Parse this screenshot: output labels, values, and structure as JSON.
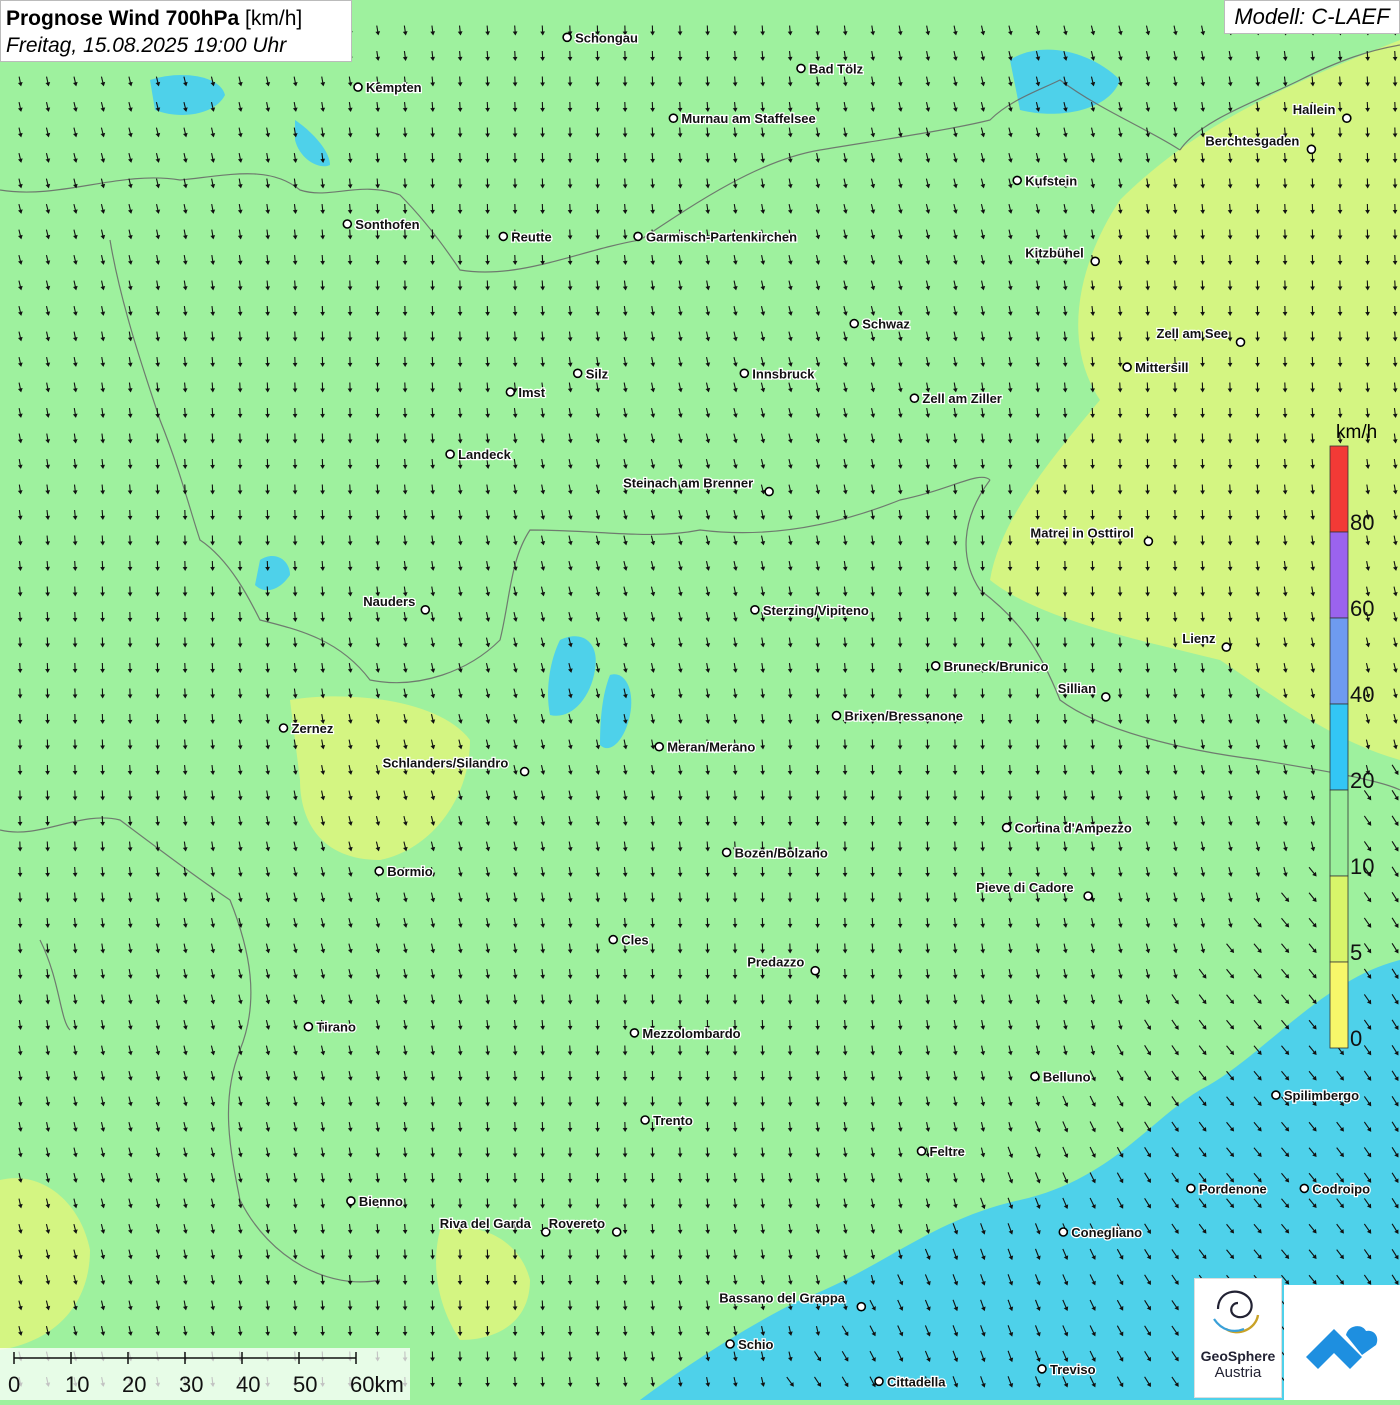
{
  "header": {
    "title_bold": "Prognose Wind 700hPa",
    "title_unit": "[km/h]",
    "datetime": "Freitag, 15.08.2025 19:00 Uhr"
  },
  "model_label": "Modell: C-LAEF",
  "colors": {
    "green_light": "#9ef19e",
    "yellow_light": "#d9f57e",
    "blue_light": "#45cdf2"
  },
  "legend": {
    "unit": "km/h",
    "classes": [
      {
        "label": "80",
        "color": "#f23a36"
      },
      {
        "label": "60",
        "color": "#9b63ee"
      },
      {
        "label": "40",
        "color": "#6e9bf0"
      },
      {
        "label": "20",
        "color": "#33c6f5"
      },
      {
        "label": "10",
        "color": "#99ef9b"
      },
      {
        "label": "5",
        "color": "#d8f56a"
      },
      {
        "label": "0",
        "color": "#f7f76a"
      }
    ]
  },
  "scale": {
    "ticks": [
      "0",
      "10",
      "20",
      "30",
      "40",
      "50",
      "60km"
    ]
  },
  "cities": [
    {
      "name": "Schongau",
      "lon": 10.9,
      "lat": 47.81
    },
    {
      "name": "Bad Tölz",
      "lon": 11.56,
      "lat": 47.76
    },
    {
      "name": "Kempten",
      "lon": 10.31,
      "lat": 47.73
    },
    {
      "name": "Murnau am Staffelsee",
      "lon": 11.2,
      "lat": 47.68
    },
    {
      "name": "Hallein",
      "lon": 13.1,
      "lat": 47.68
    },
    {
      "name": "Berchtesgaden",
      "lon": 13.0,
      "lat": 47.63
    },
    {
      "name": "Kufstein",
      "lon": 12.17,
      "lat": 47.58
    },
    {
      "name": "Sonthofen",
      "lon": 10.28,
      "lat": 47.51
    },
    {
      "name": "Reutte",
      "lon": 10.72,
      "lat": 47.49
    },
    {
      "name": "Garmisch-Partenkirchen",
      "lon": 11.1,
      "lat": 47.49
    },
    {
      "name": "Kitzbühel",
      "lon": 12.39,
      "lat": 47.45
    },
    {
      "name": "Schwaz",
      "lon": 11.71,
      "lat": 47.35
    },
    {
      "name": "Zell am See",
      "lon": 12.8,
      "lat": 47.32
    },
    {
      "name": "Innsbruck",
      "lon": 11.4,
      "lat": 47.27
    },
    {
      "name": "Mittersill",
      "lon": 12.48,
      "lat": 47.28
    },
    {
      "name": "Silz",
      "lon": 10.93,
      "lat": 47.27
    },
    {
      "name": "Imst",
      "lon": 10.74,
      "lat": 47.24
    },
    {
      "name": "Zell am Ziller",
      "lon": 11.88,
      "lat": 47.23
    },
    {
      "name": "Landeck",
      "lon": 10.57,
      "lat": 47.14
    },
    {
      "name": "Steinach am Brenner",
      "lon": 11.47,
      "lat": 47.08
    },
    {
      "name": "Matrei in Osttirol",
      "lon": 12.54,
      "lat": 47.0
    },
    {
      "name": "Nauders",
      "lon": 10.5,
      "lat": 46.89
    },
    {
      "name": "Sterzing/Vipiteno",
      "lon": 11.43,
      "lat": 46.89
    },
    {
      "name": "Lienz",
      "lon": 12.76,
      "lat": 46.83
    },
    {
      "name": "Bruneck/Brunico",
      "lon": 11.94,
      "lat": 46.8
    },
    {
      "name": "Sillian",
      "lon": 12.42,
      "lat": 46.75
    },
    {
      "name": "Brixen/Bressanone",
      "lon": 11.66,
      "lat": 46.72
    },
    {
      "name": "Zernez",
      "lon": 10.1,
      "lat": 46.7
    },
    {
      "name": "Meran/Merano",
      "lon": 11.16,
      "lat": 46.67
    },
    {
      "name": "Schlanders/Silandro",
      "lon": 10.78,
      "lat": 46.63
    },
    {
      "name": "Cortina d'Ampezzo",
      "lon": 12.14,
      "lat": 46.54
    },
    {
      "name": "Bozen/Bolzano",
      "lon": 11.35,
      "lat": 46.5
    },
    {
      "name": "Bormio",
      "lon": 10.37,
      "lat": 46.47
    },
    {
      "name": "Pieve di Cadore",
      "lon": 12.37,
      "lat": 46.43
    },
    {
      "name": "Cles",
      "lon": 11.03,
      "lat": 46.36
    },
    {
      "name": "Predazzo",
      "lon": 11.6,
      "lat": 46.31
    },
    {
      "name": "Tirano",
      "lon": 10.17,
      "lat": 46.22
    },
    {
      "name": "Mezzolombardo",
      "lon": 11.09,
      "lat": 46.21
    },
    {
      "name": "Belluno",
      "lon": 12.22,
      "lat": 46.14
    },
    {
      "name": "Spilimbergo",
      "lon": 12.9,
      "lat": 46.11
    },
    {
      "name": "Trento",
      "lon": 11.12,
      "lat": 46.07
    },
    {
      "name": "Feltre",
      "lon": 11.9,
      "lat": 46.02
    },
    {
      "name": "Pordenone",
      "lon": 12.66,
      "lat": 45.96
    },
    {
      "name": "Codroipo",
      "lon": 12.98,
      "lat": 45.96
    },
    {
      "name": "Bienno",
      "lon": 10.29,
      "lat": 45.94
    },
    {
      "name": "Riva del Garda",
      "lon": 10.84,
      "lat": 45.89
    },
    {
      "name": "Rovereto",
      "lon": 11.04,
      "lat": 45.89
    },
    {
      "name": "Conegliano",
      "lon": 12.3,
      "lat": 45.89
    },
    {
      "name": "Bassano del Grappa",
      "lon": 11.73,
      "lat": 45.77
    },
    {
      "name": "Schio",
      "lon": 11.36,
      "lat": 45.71
    },
    {
      "name": "Treviso",
      "lon": 12.24,
      "lat": 45.67
    },
    {
      "name": "Cittadella",
      "lon": 11.78,
      "lat": 45.65
    }
  ],
  "logos": {
    "geosphere_line1": "GeoSphere",
    "geosphere_line2": "Austria"
  }
}
